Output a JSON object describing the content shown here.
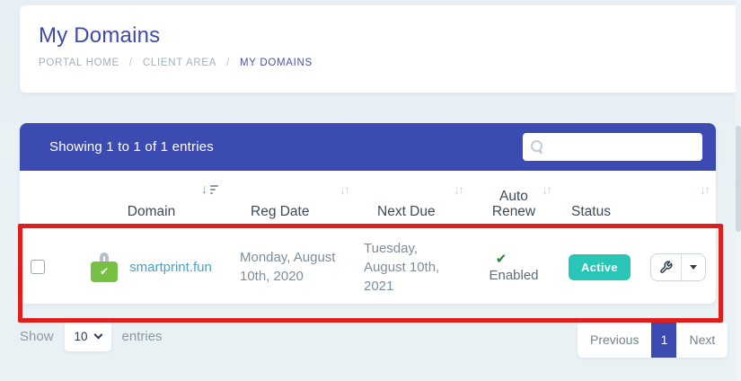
{
  "page_header": {
    "title": "My Domains",
    "breadcrumb": {
      "items": [
        {
          "label": "PORTAL HOME"
        },
        {
          "label": "CLIENT AREA"
        },
        {
          "label": "MY DOMAINS"
        }
      ],
      "separator": "/"
    }
  },
  "domains_table": {
    "summary": "Showing 1 to 1 of 1 entries",
    "search_value": "",
    "columns": {
      "domain": "Domain",
      "reg_date": "Reg Date",
      "next_due": "Next Due",
      "auto_renew": "Auto Renew",
      "status": "Status"
    },
    "row": {
      "domain": "smartprint.fun",
      "reg_date": "Monday, August 10th, 2020",
      "next_due": "Tuesday, August 10th, 2021",
      "auto_renew_state": "Enabled",
      "status": "Active"
    }
  },
  "footer": {
    "show_label": "Show",
    "entries_label": "entries",
    "page_size": "10",
    "pagination": {
      "previous": "Previous",
      "page": "1",
      "next": "Next"
    }
  },
  "icons": {
    "sort_down": "↓",
    "sort_up": "↑",
    "check": "✔"
  },
  "colors": {
    "accent_indigo": "#3c4bb1",
    "status_teal": "#29c5b6",
    "domain_link_blue": "#4da0c8",
    "lock_green": "#76c043",
    "check_green": "#2e7d32",
    "annotation_red": "#e01e1e"
  }
}
